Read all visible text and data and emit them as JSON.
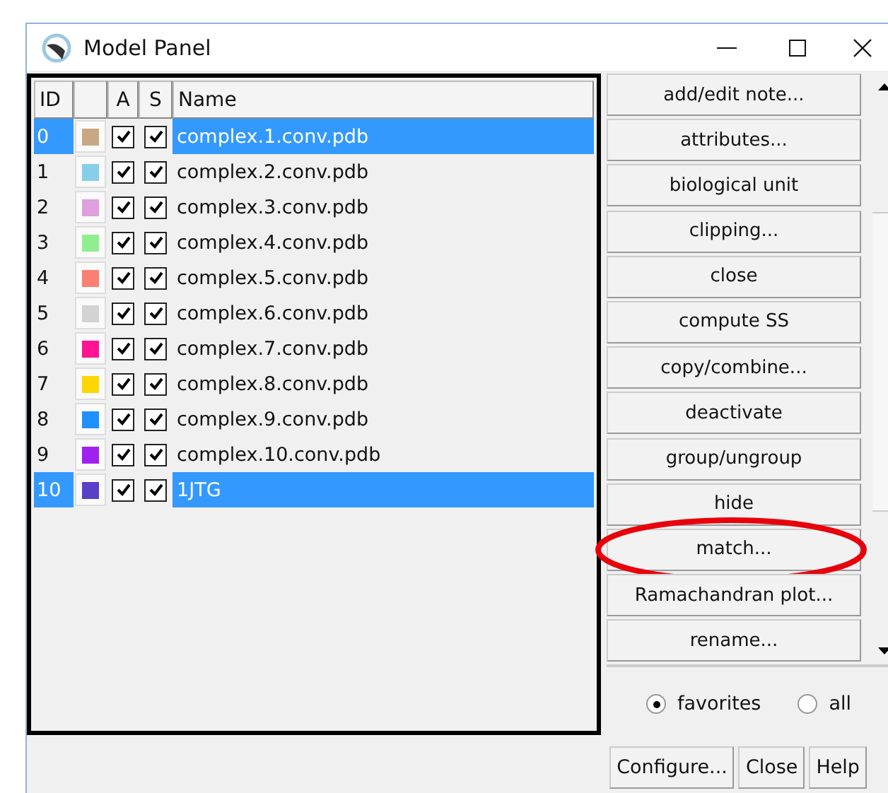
{
  "window": {
    "title": "Model Panel"
  },
  "table": {
    "columns": [
      "ID",
      "",
      "A",
      "S",
      "Name"
    ],
    "rows": [
      {
        "id": "0",
        "color": "#c8a882",
        "active": true,
        "shown": true,
        "name": "complex.1.conv.pdb",
        "selected": true
      },
      {
        "id": "1",
        "color": "#87ceeb",
        "active": true,
        "shown": true,
        "name": "complex.2.conv.pdb",
        "selected": false
      },
      {
        "id": "2",
        "color": "#dda0dd",
        "active": true,
        "shown": true,
        "name": "complex.3.conv.pdb",
        "selected": false
      },
      {
        "id": "3",
        "color": "#90ee90",
        "active": true,
        "shown": true,
        "name": "complex.4.conv.pdb",
        "selected": false
      },
      {
        "id": "4",
        "color": "#fa8072",
        "active": true,
        "shown": true,
        "name": "complex.5.conv.pdb",
        "selected": false
      },
      {
        "id": "5",
        "color": "#d3d3d3",
        "active": true,
        "shown": true,
        "name": "complex.6.conv.pdb",
        "selected": false
      },
      {
        "id": "6",
        "color": "#ff1493",
        "active": true,
        "shown": true,
        "name": "complex.7.conv.pdb",
        "selected": false
      },
      {
        "id": "7",
        "color": "#ffd700",
        "active": true,
        "shown": true,
        "name": "complex.8.conv.pdb",
        "selected": false
      },
      {
        "id": "8",
        "color": "#1e90ff",
        "active": true,
        "shown": true,
        "name": "complex.9.conv.pdb",
        "selected": false
      },
      {
        "id": "9",
        "color": "#a020f0",
        "active": true,
        "shown": true,
        "name": "complex.10.conv.pdb",
        "selected": false
      },
      {
        "id": "10",
        "color": "#5a3fc8",
        "active": true,
        "shown": true,
        "name": "1JTG",
        "selected": true
      }
    ]
  },
  "commands": [
    {
      "label": "add/edit note...",
      "circled": false
    },
    {
      "label": "attributes...",
      "circled": false
    },
    {
      "label": "biological unit",
      "circled": false
    },
    {
      "label": "clipping...",
      "circled": false
    },
    {
      "label": "close",
      "circled": false
    },
    {
      "label": "compute SS",
      "circled": false
    },
    {
      "label": "copy/combine...",
      "circled": false
    },
    {
      "label": "deactivate",
      "circled": false
    },
    {
      "label": "group/ungroup",
      "circled": false
    },
    {
      "label": "hide",
      "circled": false
    },
    {
      "label": "match...",
      "circled": true
    },
    {
      "label": "Ramachandran plot...",
      "circled": false
    },
    {
      "label": "rename...",
      "circled": false
    }
  ],
  "filter": [
    {
      "label": "favorites",
      "selected": true
    },
    {
      "label": "all",
      "selected": false
    }
  ],
  "buttons": [
    "Configure...",
    "Close",
    "Help"
  ]
}
